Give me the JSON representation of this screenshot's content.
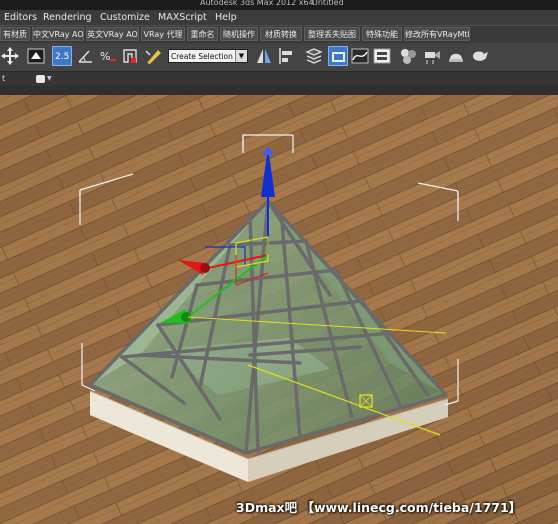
{
  "title_bar": {
    "app_title": "Autodesk 3ds Max  2012 x64",
    "doc_title": "Untitled"
  },
  "menu": {
    "items": [
      "Editors",
      "Rendering",
      "Customize",
      "MAXScript",
      "Help"
    ]
  },
  "quad_buttons": [
    "有材质",
    "中文VRay AO",
    "英文VRay AO",
    "VRay 代理",
    "重命名",
    "随机操作",
    "材质转换",
    "整理丢失贴图",
    "特殊功能",
    "修改所有VRayMtl"
  ],
  "toolbar": {
    "snap_value": "2.5",
    "selection_set_placeholder": "Create Selection Se"
  },
  "ribbon": {
    "item": "t"
  },
  "viewport": {
    "floor_color": "#9a7048",
    "glass_color": "#7fa27a",
    "frame_color": "#6d6d6d",
    "base_color": "#e9e4d4",
    "gizmo_x_color": "#e01818",
    "gizmo_y_color": "#1fbf1f",
    "gizmo_z_color": "#1030d0"
  },
  "watermark": "3Dmax吧 【www.linecg.com/tieba/1771】"
}
